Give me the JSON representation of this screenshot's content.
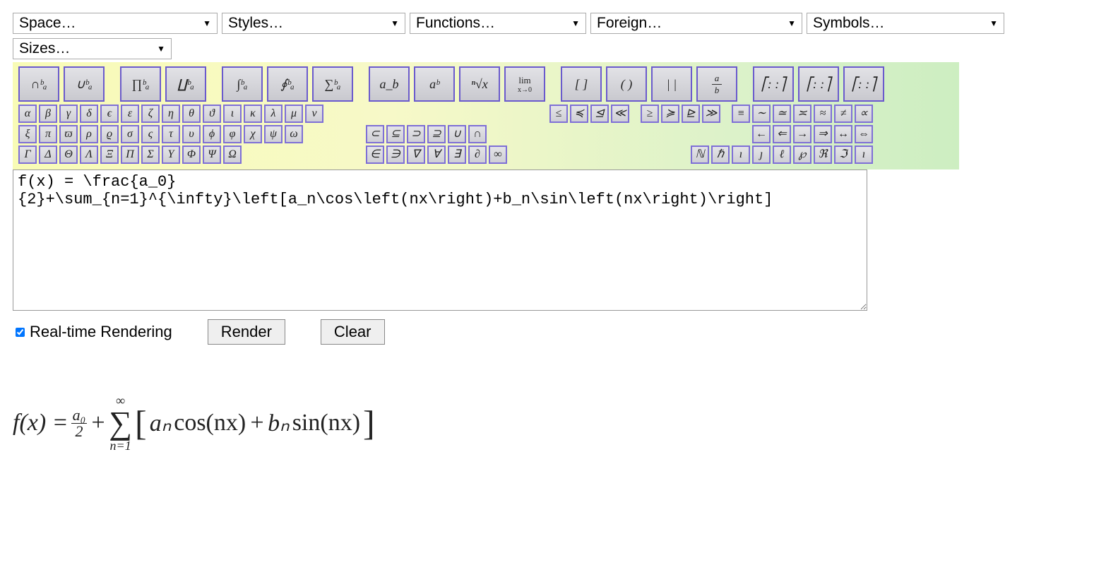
{
  "dropdowns": {
    "space": "Space…",
    "styles": "Styles…",
    "functions": "Functions…",
    "foreign": "Foreign…",
    "symbols": "Symbols…",
    "sizes": "Sizes…"
  },
  "big_buttons": {
    "cap": "∩ᵇₐ",
    "cup": "∪ᵇₐ",
    "prod": "∏ᵇₐ",
    "coprod": "∐ᵇₐ",
    "int": "∫ᵇₐ",
    "oint": "∮ᵇₐ",
    "sum": "∑ᵇₐ",
    "sub": "a_b",
    "sup": "aᵇ",
    "root": "ⁿ√x",
    "lim": "lim",
    "brackets": "[ ]",
    "parens": "( )",
    "bars": "| |",
    "frac": "a⁄b",
    "matrix1": "⎡: :⎤",
    "matrix2": "⎡: :⎤",
    "matrix3": "⎡: :⎤"
  },
  "greek_lower_row1": [
    "α",
    "β",
    "γ",
    "δ",
    "ϵ",
    "ε",
    "ζ",
    "η",
    "θ",
    "ϑ",
    "ι",
    "κ",
    "λ",
    "μ",
    "ν"
  ],
  "greek_lower_row2": [
    "ξ",
    "π",
    "ϖ",
    "ρ",
    "ϱ",
    "σ",
    "ς",
    "τ",
    "υ",
    "ϕ",
    "φ",
    "χ",
    "ψ",
    "ω"
  ],
  "greek_upper": [
    "Γ",
    "Δ",
    "Θ",
    "Λ",
    "Ξ",
    "Π",
    "Σ",
    "Υ",
    "Φ",
    "Ψ",
    "Ω"
  ],
  "rel_le": [
    "≤",
    "≼",
    "⊴",
    "≪"
  ],
  "rel_ge": [
    "≥",
    "≽",
    "⊵",
    "≫"
  ],
  "rel_eq": [
    "≡",
    "∼",
    "≃",
    "≍",
    "≈",
    "≠",
    "∝"
  ],
  "set_row": [
    "⊂",
    "⊆",
    "⊃",
    "⊇",
    "∪",
    "∩"
  ],
  "arrows": [
    "←",
    "⇐",
    "→",
    "⇒",
    "↔",
    "⇔"
  ],
  "elem_row": [
    "∈",
    "∋",
    "∇",
    "∀",
    "∃",
    "∂",
    "∞"
  ],
  "special": [
    "ℕ",
    "ℏ",
    "ı",
    "ȷ",
    "ℓ",
    "℘",
    "ℜ",
    "ℑ",
    "ı"
  ],
  "textarea_value": "f(x) = \\frac{a_0}\n{2}+\\sum_{n=1}^{\\infty}\\left[a_n\\cos\\left(nx\\right)+b_n\\sin\\left(nx\\right)\\right]",
  "controls": {
    "realtime_label": "Real-time Rendering",
    "realtime_checked": true,
    "render_label": "Render",
    "clear_label": "Clear"
  },
  "output": {
    "prefix": "f(x) =",
    "frac_num": "a₀",
    "frac_den": "2",
    "plus": "+",
    "sum_top": "∞",
    "sum_sym": "∑",
    "sum_bot": "n=1",
    "lbr": "[",
    "term_a": "aₙ",
    "cos": "cos(nx)",
    "plus2": "+",
    "term_b": "bₙ",
    "sin": "sin(nx)",
    "rbr": "]"
  }
}
